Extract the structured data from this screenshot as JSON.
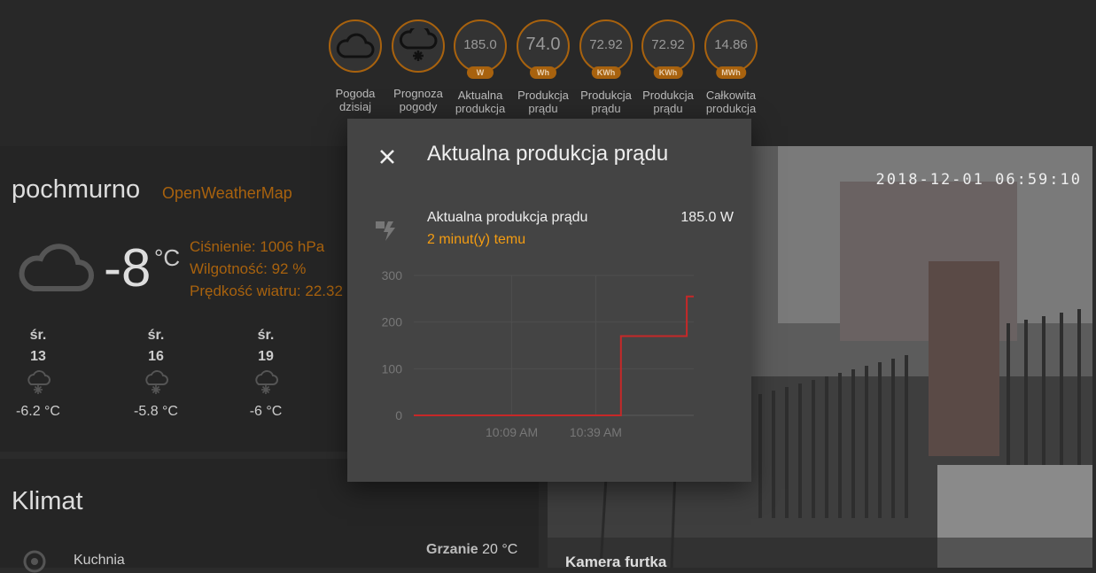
{
  "badges": [
    {
      "label": "Pogoda dzisiaj",
      "icon": "cloud-icon"
    },
    {
      "label": "Prognoza pogody",
      "icon": "cloud-snow-icon"
    },
    {
      "value": "185.0",
      "unit": "W",
      "label": "Aktualna produkcja prądu"
    },
    {
      "value": "74.0",
      "unit": "Wh",
      "label": "Produkcja prądu dzienna"
    },
    {
      "value": "72.92",
      "unit": "KWh",
      "label": "Produkcja prądu miesięcz..."
    },
    {
      "value": "72.92",
      "unit": "KWh",
      "label": "Produkcja prądu roczna"
    },
    {
      "value": "14.86",
      "unit": "MWh",
      "label": "Całkowita produkcja prądu"
    }
  ],
  "weather": {
    "condition": "pochmurno",
    "source": "OpenWeatherMap",
    "temperature": "-8",
    "temp_unit": "°C",
    "pressure": "Ciśnienie: 1006 hPa",
    "humidity": "Wilgotność: 92 %",
    "wind": "Prędkość wiatru: 22.32",
    "forecast": [
      {
        "day": "śr.",
        "hour": "13",
        "temp": "-6.2 °C",
        "icon": "snow-icon"
      },
      {
        "day": "śr.",
        "hour": "16",
        "temp": "-5.8 °C",
        "icon": "snow-icon"
      },
      {
        "day": "śr.",
        "hour": "19",
        "temp": "-6 °C",
        "icon": "snow-icon"
      }
    ]
  },
  "climate": {
    "title": "Klimat",
    "entity": "Kuchnia",
    "mode_label": "Grzanie",
    "mode_temp": "20 °C"
  },
  "camera": {
    "timestamp": "2018-12-01 06:59:10",
    "name": "Kamera furtka"
  },
  "dialog": {
    "title": "Aktualna produkcja prądu",
    "entity_name": "Aktualna produkcja prądu",
    "entity_value": "185.0 W",
    "last_changed": "2 minut(y) temu"
  },
  "colors": {
    "accent": "#a8620e",
    "orange": "#f39c12",
    "line": "#c62828"
  },
  "chart_data": {
    "type": "line",
    "title": "",
    "xlabel": "",
    "ylabel": "",
    "ylim": [
      0,
      300
    ],
    "yticks": [
      "0",
      "100",
      "200",
      "300"
    ],
    "xticks": [
      "10:09 AM",
      "10:39 AM"
    ],
    "xtick_values": [
      0.35,
      0.65
    ],
    "grid": true,
    "series": [
      {
        "x": [
          0.0,
          0.74,
          0.74,
          0.975,
          0.975,
          1.0
        ],
        "y": [
          0,
          0,
          170,
          170,
          255,
          255
        ]
      }
    ]
  }
}
